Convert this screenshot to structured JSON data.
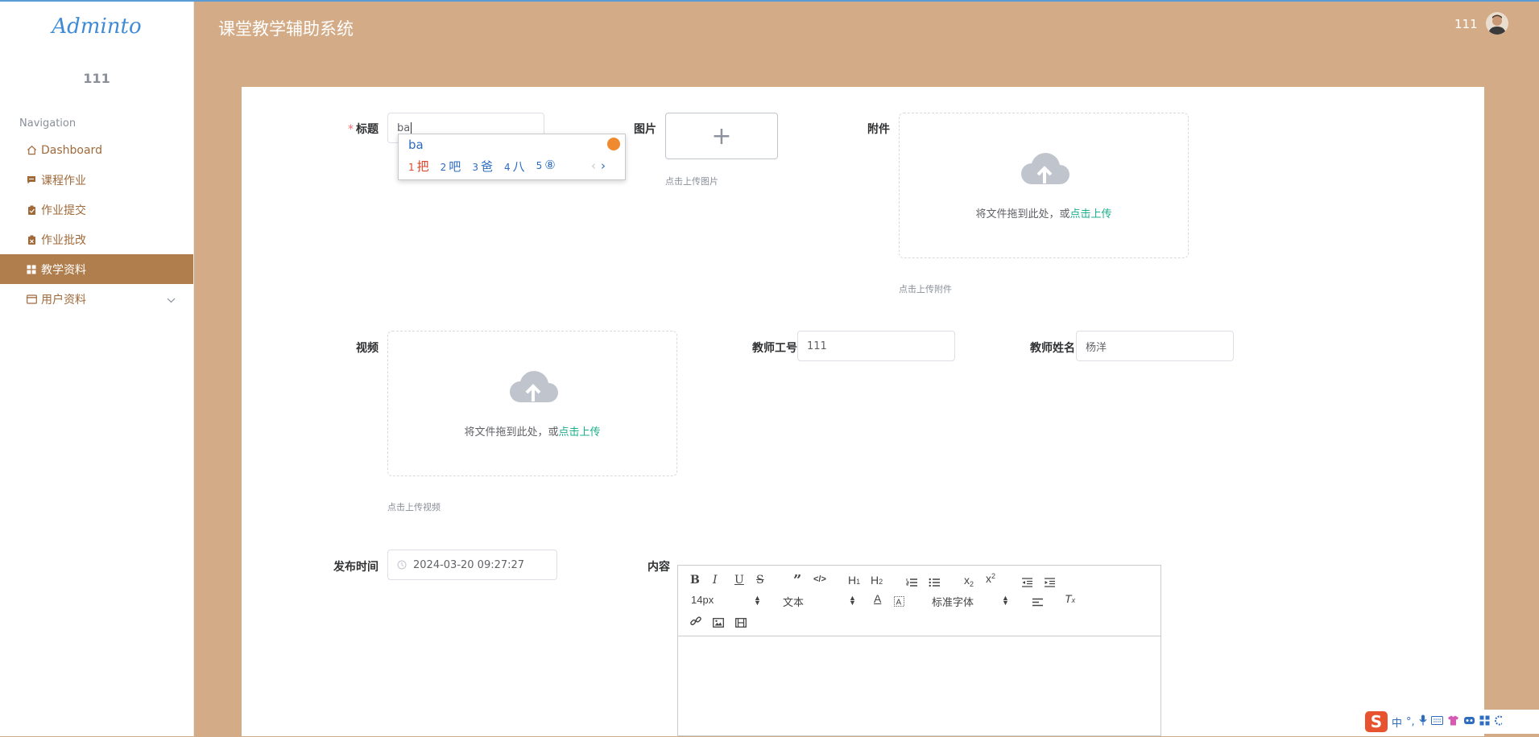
{
  "header": {
    "app_title": "课堂教学辅助系统",
    "user": "111"
  },
  "sidebar": {
    "logo": "Adminto",
    "username": "111",
    "nav_title": "Navigation",
    "items": [
      {
        "label": "Dashboard",
        "icon": "home-icon"
      },
      {
        "label": "课程作业",
        "icon": "chat-icon"
      },
      {
        "label": "作业提交",
        "icon": "clipboard-icon"
      },
      {
        "label": "作业批改",
        "icon": "clipboard-icon"
      },
      {
        "label": "教学资料",
        "icon": "grid-icon",
        "active": true
      },
      {
        "label": "用户资料",
        "icon": "id-card-icon",
        "expandable": true
      }
    ]
  },
  "form": {
    "title_label": "标题",
    "title_value": "ba",
    "image_label": "图片",
    "image_tip": "点击上传图片",
    "attachment_label": "附件",
    "attachment_drop_text": "将文件拖到此处，或",
    "attachment_drop_link": "点击上传",
    "attachment_tip": "点击上传附件",
    "video_label": "视频",
    "video_drop_text": "将文件拖到此处，或",
    "video_drop_link": "点击上传",
    "video_tip": "点击上传视频",
    "teacher_id_label": "教师工号",
    "teacher_id_value": "111",
    "teacher_name_label": "教师姓名",
    "teacher_name_value": "杨洋",
    "publish_time_label": "发布时间",
    "publish_time_value": "2024-03-20 09:27:27",
    "content_label": "内容"
  },
  "ime_popup": {
    "composition": "ba",
    "candidates": [
      {
        "n": "1",
        "text": "把"
      },
      {
        "n": "2",
        "text": "吧"
      },
      {
        "n": "3",
        "text": "爸"
      },
      {
        "n": "4",
        "text": "八"
      },
      {
        "n": "5",
        "text": "⑧"
      }
    ]
  },
  "editor": {
    "font_size": "14px",
    "header_select": "文本",
    "font_family": "标准字体"
  },
  "ime_bar": {
    "mode": "中"
  },
  "colors": {
    "background": "#d3ab86",
    "sidebar_active": "#b07d4d",
    "nav_text": "#a0693a",
    "link_green": "#1aaf8b",
    "required_red": "#f56c6c"
  }
}
